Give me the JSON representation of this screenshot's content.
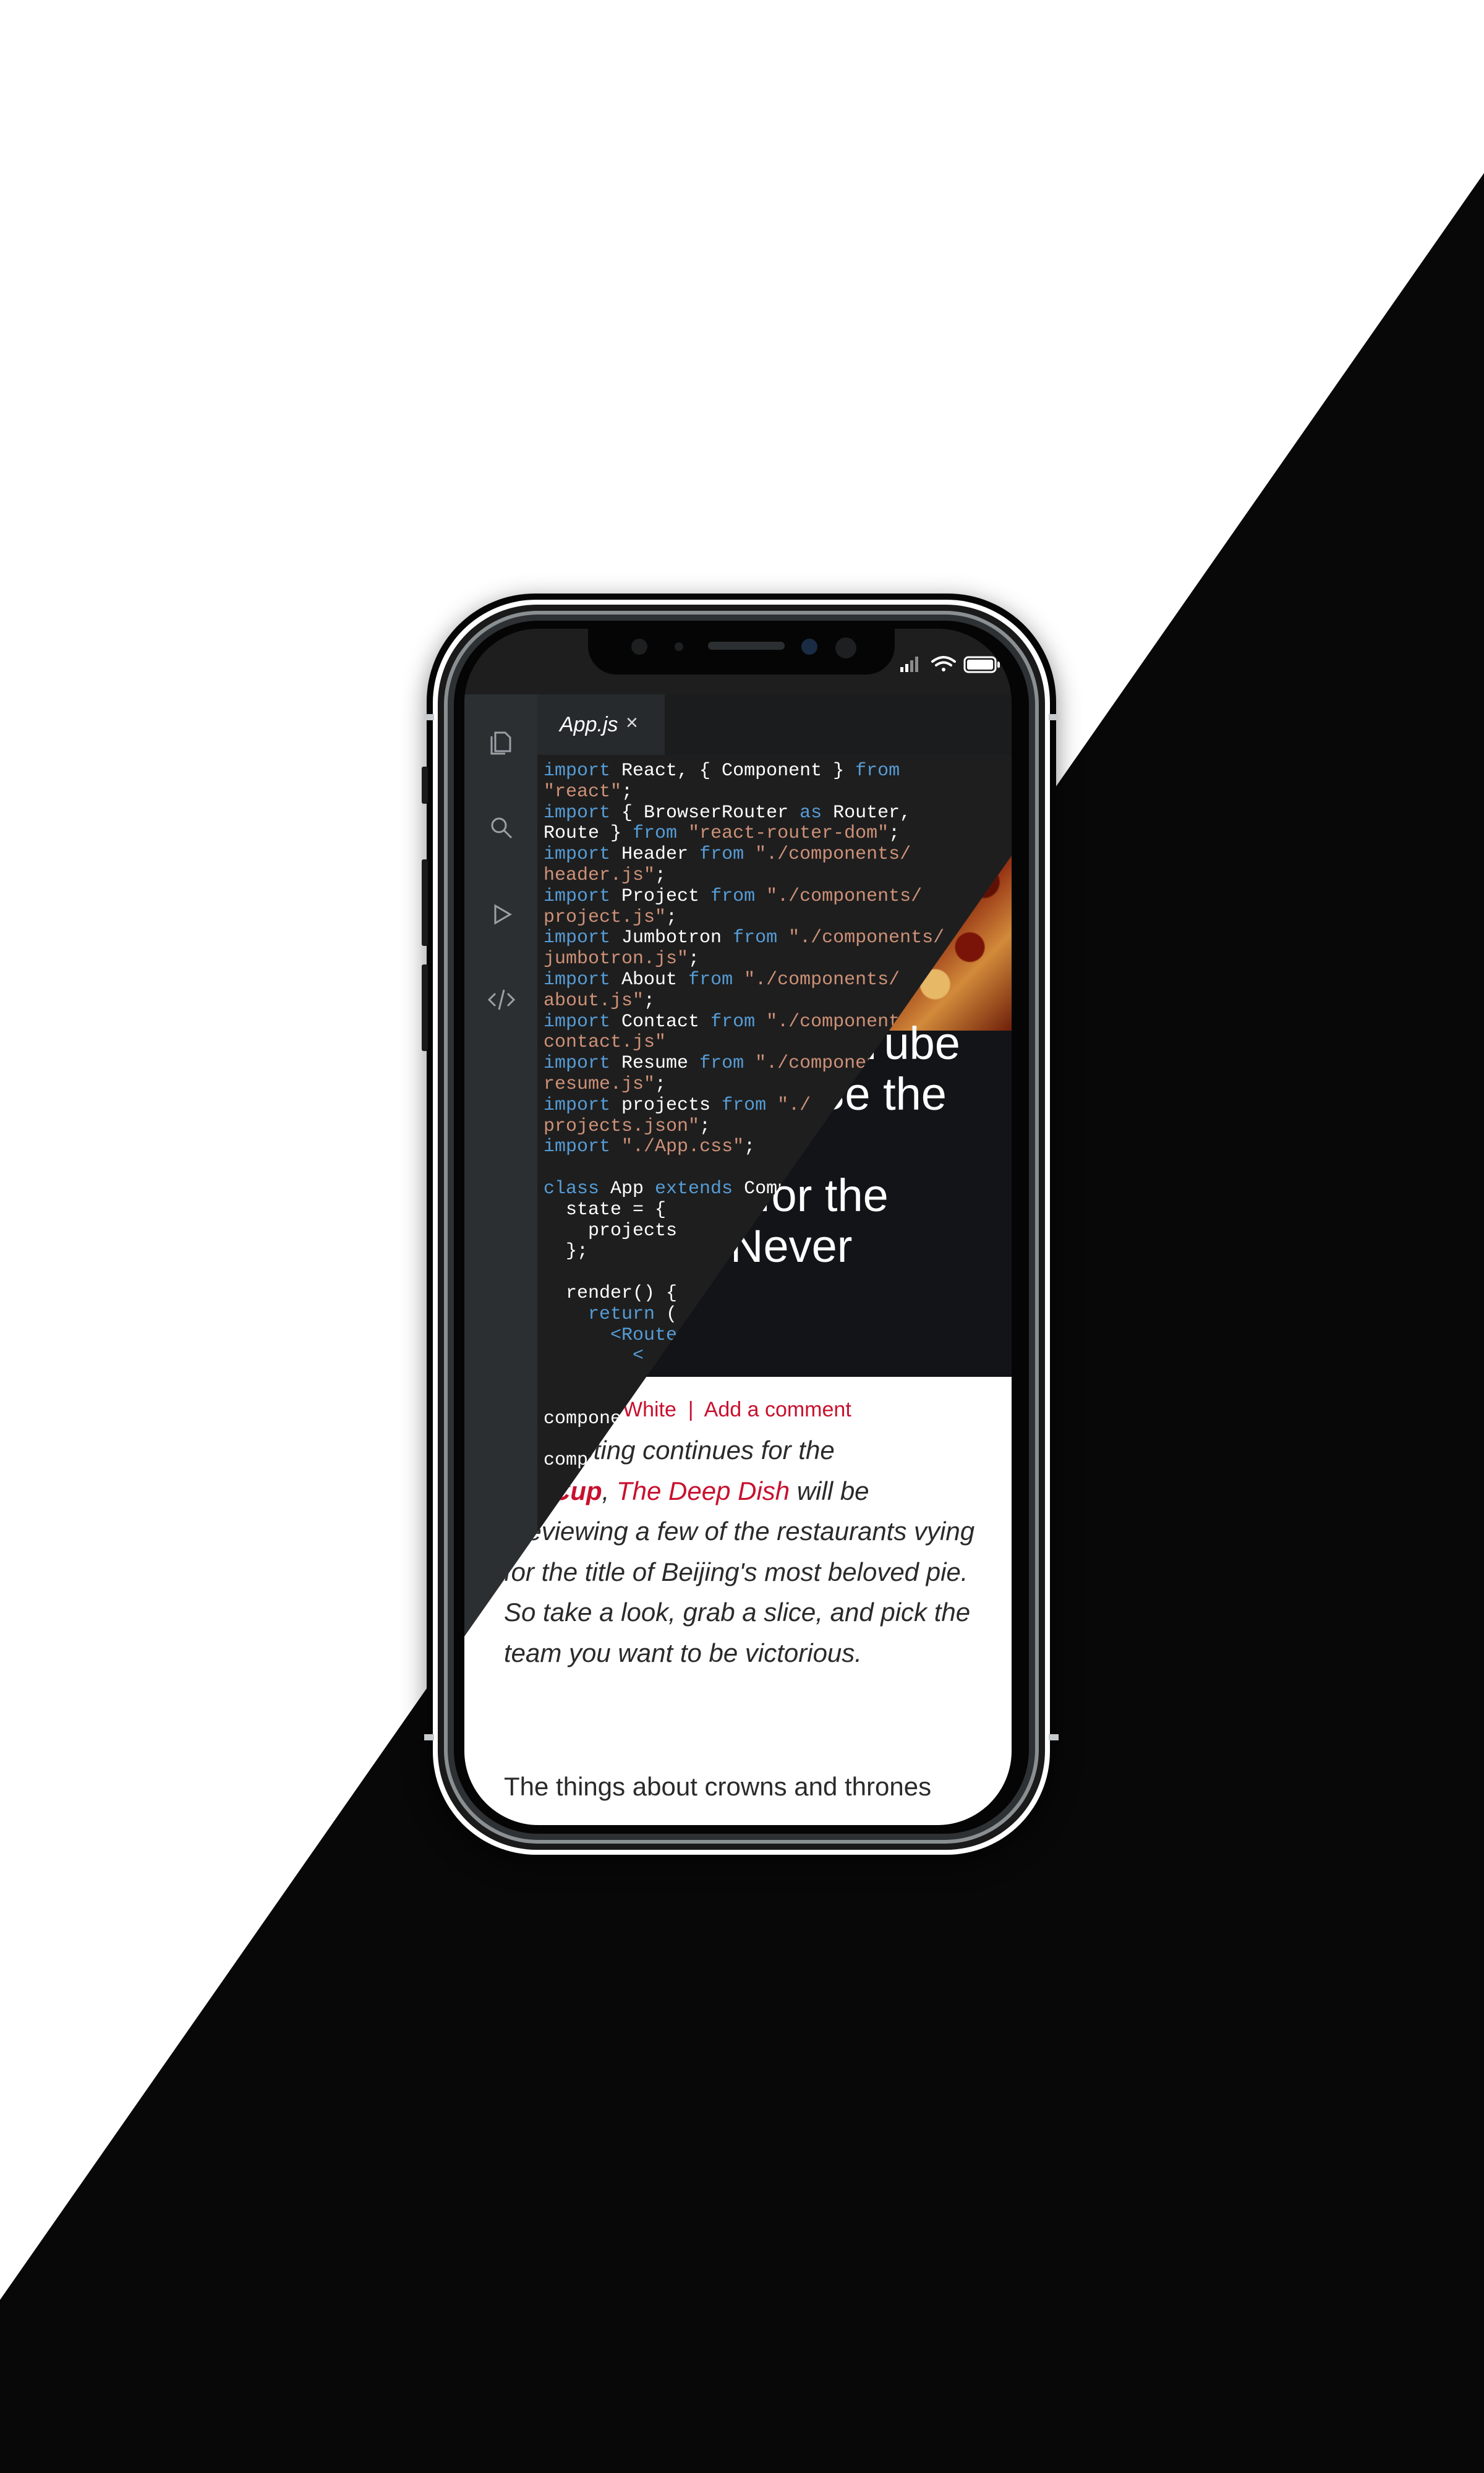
{
  "editor": {
    "tab_label": "App.js",
    "tab_close": "×",
    "activity_icons": [
      "files-icon",
      "search-icon",
      "run-icon",
      "code-icon"
    ],
    "code_lines": [
      [
        {
          "t": "import",
          "c": "k"
        },
        {
          "t": " React, { Component } ",
          "c": ""
        },
        {
          "t": "from",
          "c": "k"
        }
      ],
      [
        {
          "t": "\"react\"",
          "c": "s"
        },
        {
          "t": ";",
          "c": ""
        }
      ],
      [
        {
          "t": "import",
          "c": "k"
        },
        {
          "t": " { BrowserRouter ",
          "c": ""
        },
        {
          "t": "as",
          "c": "k"
        },
        {
          "t": " Router,",
          "c": ""
        }
      ],
      [
        {
          "t": "Route } ",
          "c": ""
        },
        {
          "t": "from",
          "c": "k"
        },
        {
          "t": " ",
          "c": ""
        },
        {
          "t": "\"react-router-dom\"",
          "c": "s"
        },
        {
          "t": ";",
          "c": ""
        }
      ],
      [
        {
          "t": "import",
          "c": "k"
        },
        {
          "t": " Header ",
          "c": ""
        },
        {
          "t": "from",
          "c": "k"
        },
        {
          "t": " ",
          "c": ""
        },
        {
          "t": "\"./components/",
          "c": "s"
        }
      ],
      [
        {
          "t": "header.js\"",
          "c": "s"
        },
        {
          "t": ";",
          "c": ""
        }
      ],
      [
        {
          "t": "import",
          "c": "k"
        },
        {
          "t": " Project ",
          "c": ""
        },
        {
          "t": "from",
          "c": "k"
        },
        {
          "t": " ",
          "c": ""
        },
        {
          "t": "\"./components/",
          "c": "s"
        }
      ],
      [
        {
          "t": "project.js\"",
          "c": "s"
        },
        {
          "t": ";",
          "c": ""
        }
      ],
      [
        {
          "t": "import",
          "c": "k"
        },
        {
          "t": " Jumbotron ",
          "c": ""
        },
        {
          "t": "from",
          "c": "k"
        },
        {
          "t": " ",
          "c": ""
        },
        {
          "t": "\"./components/",
          "c": "s"
        }
      ],
      [
        {
          "t": "jumbotron.js\"",
          "c": "s"
        },
        {
          "t": ";",
          "c": ""
        }
      ],
      [
        {
          "t": "import",
          "c": "k"
        },
        {
          "t": " About ",
          "c": ""
        },
        {
          "t": "from",
          "c": "k"
        },
        {
          "t": " ",
          "c": ""
        },
        {
          "t": "\"./components/",
          "c": "s"
        }
      ],
      [
        {
          "t": "about.js\"",
          "c": "s"
        },
        {
          "t": ";",
          "c": ""
        }
      ],
      [
        {
          "t": "import",
          "c": "k"
        },
        {
          "t": " Contact ",
          "c": ""
        },
        {
          "t": "from",
          "c": "k"
        },
        {
          "t": " ",
          "c": ""
        },
        {
          "t": "\"./components/",
          "c": "s"
        }
      ],
      [
        {
          "t": "contact.js\"",
          "c": "s"
        }
      ],
      [
        {
          "t": "import",
          "c": "k"
        },
        {
          "t": " Resume ",
          "c": ""
        },
        {
          "t": "from",
          "c": "k"
        },
        {
          "t": " ",
          "c": ""
        },
        {
          "t": "\"./components/",
          "c": "s"
        }
      ],
      [
        {
          "t": "resume.js\"",
          "c": "s"
        },
        {
          "t": ";",
          "c": ""
        }
      ],
      [
        {
          "t": "import",
          "c": "k"
        },
        {
          "t": " projects ",
          "c": ""
        },
        {
          "t": "from",
          "c": "k"
        },
        {
          "t": " ",
          "c": ""
        },
        {
          "t": "\"./",
          "c": "s"
        }
      ],
      [
        {
          "t": "projects.json\"",
          "c": "s"
        },
        {
          "t": ";",
          "c": ""
        }
      ],
      [
        {
          "t": "import",
          "c": "k"
        },
        {
          "t": " ",
          "c": ""
        },
        {
          "t": "\"./App.css\"",
          "c": "s"
        },
        {
          "t": ";",
          "c": ""
        }
      ],
      [
        {
          "t": "",
          "c": ""
        }
      ],
      [
        {
          "t": "class",
          "c": "k"
        },
        {
          "t": " App ",
          "c": ""
        },
        {
          "t": "extends",
          "c": "k"
        },
        {
          "t": " Component {",
          "c": ""
        }
      ],
      [
        {
          "t": "  state = {",
          "c": ""
        }
      ],
      [
        {
          "t": "    projects",
          "c": ""
        }
      ],
      [
        {
          "t": "  };",
          "c": ""
        }
      ],
      [
        {
          "t": "",
          "c": ""
        }
      ],
      [
        {
          "t": "  render() {",
          "c": ""
        }
      ],
      [
        {
          "t": "    ",
          "c": ""
        },
        {
          "t": "return",
          "c": "k"
        },
        {
          "t": " (",
          "c": ""
        }
      ],
      [
        {
          "t": "      ",
          "c": ""
        },
        {
          "t": "<Router>",
          "c": "k"
        }
      ],
      [
        {
          "t": "        ",
          "c": ""
        },
        {
          "t": "<",
          "c": "k"
        }
      ],
      [
        {
          "t": "",
          "c": ""
        }
      ],
      [
        {
          "t": "",
          "c": ""
        }
      ],
      [
        {
          "t": "compone",
          "c": ""
        }
      ],
      [
        {
          "t": "",
          "c": ""
        }
      ],
      [
        {
          "t": "comp",
          "c": ""
        }
      ]
    ]
  },
  "article": {
    "hero_lines": [
      "Tube",
      "Be the",
      "",
      "for the",
      "Never"
    ],
    "byline": "White  |  Add a comment",
    "intro": {
      "pre": "nline voting continues for the",
      "cup": "zza Cup",
      "comma": ", ",
      "deep_dish": "The Deep Dish",
      "post": " will be previewing a few of the restaurants vying for the title of Beijing's most beloved pie. So take a look, grab a slice, and pick the team you want to be victorious."
    },
    "para2": "The things about crowns and thrones"
  },
  "colors": {
    "keyword": "#569cd6",
    "string": "#ce9178",
    "accent_red": "#c8102e"
  }
}
